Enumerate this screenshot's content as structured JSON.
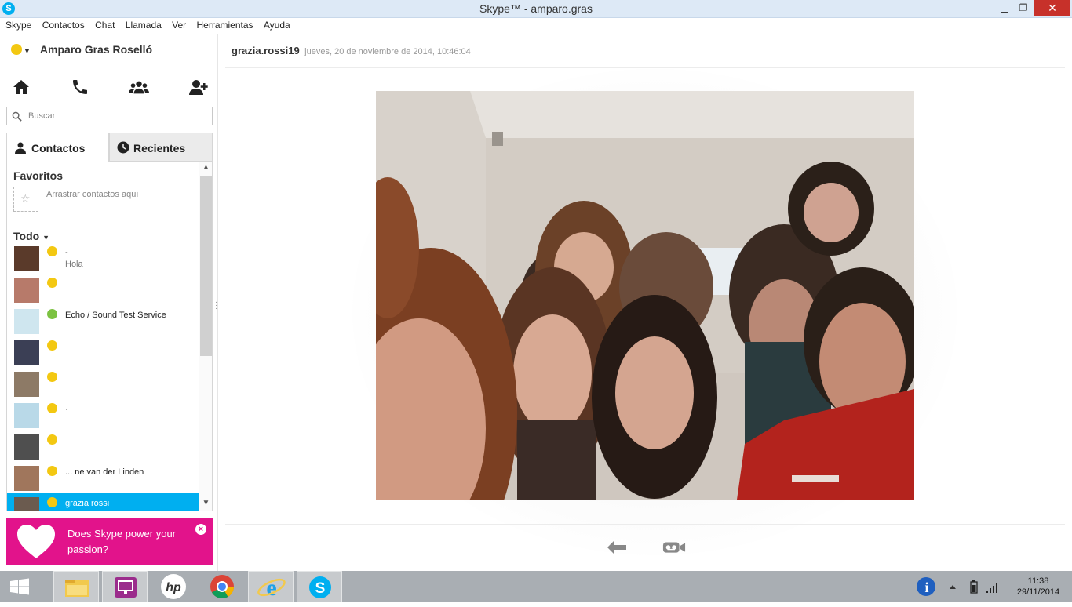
{
  "window": {
    "title": "Skype™ - amparo.gras",
    "controls": {
      "minimize": "▁",
      "maximize": "❐",
      "close": "✕"
    }
  },
  "menu": [
    "Skype",
    "Contactos",
    "Chat",
    "Llamada",
    "Ver",
    "Herramientas",
    "Ayuda"
  ],
  "profile": {
    "name": "Amparo Gras Roselló",
    "status_color": "#f3c812"
  },
  "nav_icons": [
    "home-icon",
    "phone-icon",
    "group-icon",
    "add-contact-icon"
  ],
  "search": {
    "placeholder": "Buscar"
  },
  "tabs": [
    {
      "label": "Contactos",
      "icon": "person-icon"
    },
    {
      "label": "Recientes",
      "icon": "clock-icon"
    }
  ],
  "favorites": {
    "title": "Favoritos",
    "hint": "Arrastrar contactos aquí"
  },
  "all": {
    "title": "Todo"
  },
  "contacts": [
    {
      "name": "-",
      "sub": "Hola",
      "status": "away",
      "avatar": "#5a3a2a"
    },
    {
      "name": "",
      "sub": "",
      "status": "away",
      "avatar": "#b77a6a"
    },
    {
      "name": "Echo / Sound Test Service",
      "sub": "",
      "status": "online",
      "avatar": "#cfe6ef"
    },
    {
      "name": "",
      "sub": "",
      "status": "away",
      "avatar": "#3b3f55"
    },
    {
      "name": "",
      "sub": "",
      "status": "away",
      "avatar": "#8d7a66"
    },
    {
      "name": "·",
      "sub": "",
      "status": "away",
      "avatar": "#b9d9e8"
    },
    {
      "name": "",
      "sub": "",
      "status": "away",
      "avatar": "#4f4f4f"
    },
    {
      "name": "... ne van der Linden",
      "sub": "",
      "status": "away",
      "avatar": "#a0765c"
    },
    {
      "name": "grazia rossi",
      "sub": "",
      "status": "away",
      "avatar": "#6b5b4f",
      "active": true
    }
  ],
  "promo": {
    "text": "Does Skype power your passion?",
    "close": "×"
  },
  "chat": {
    "sender": "grazia.rossi19",
    "timestamp": "jueves, 20 de noviembre de 2014, 10:46:04"
  },
  "bottom_actions": [
    "back-arrow-icon",
    "video-message-icon"
  ],
  "taskbar": {
    "apps": [
      "windows-start-icon",
      "file-explorer-icon",
      "presentation-app-icon",
      "hp-icon",
      "chrome-icon",
      "internet-explorer-icon",
      "skype-icon"
    ],
    "time": "11:38",
    "date": "29/11/2014"
  },
  "colors": {
    "skype_blue": "#00aff0",
    "promo_pink": "#e2138b",
    "away_yellow": "#f3c812",
    "online_green": "#7cc242"
  }
}
